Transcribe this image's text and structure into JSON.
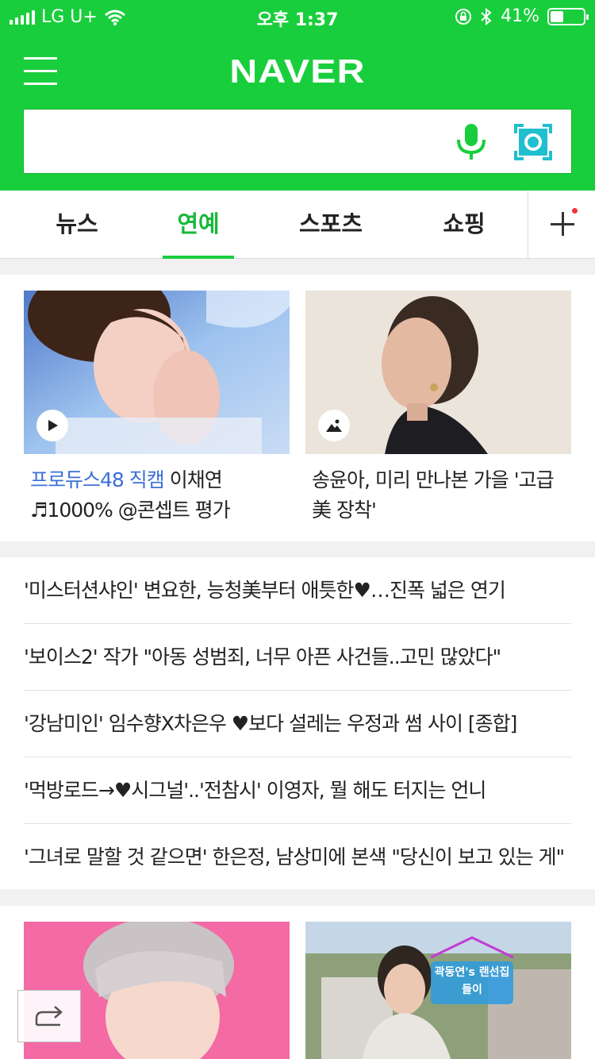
{
  "status": {
    "carrier": "LG U+",
    "time": "오후 1:37",
    "battery_text": "41%",
    "battery_level": 0.41
  },
  "header": {
    "logo": "NAVER",
    "search_value": ""
  },
  "tabs": [
    {
      "label": "뉴스",
      "active": false
    },
    {
      "label": "연예",
      "active": true
    },
    {
      "label": "스포츠",
      "active": false
    },
    {
      "label": "쇼핑",
      "active": false
    }
  ],
  "cards": [
    {
      "tag": "프로듀스48 직캠",
      "title": " 이채연 ♬1000% @콘셉트 평가",
      "media": "play-icon"
    },
    {
      "title": "송윤아, 미리 만나본 가을 '고급美 장착'",
      "media": "photo-icon"
    }
  ],
  "news": [
    "'미스터션샤인' 변요한, 능청美부터 애틋한♥…진폭 넓은 연기",
    "'보이스2' 작가 \"아동 성범죄, 너무 아픈 사건들..고민 많았다\"",
    "'강남미인' 임수향X차은우 ♥보다 설레는 우정과 썸 사이 [종합]",
    "'먹방로드→♥시그널'..'전참시' 이영자, 뭘 해도 터지는 언니",
    "'그녀로 말할 것 같으면' 한은정, 남상미에 본색 \"당신이 보고 있는 게\""
  ],
  "lower_cards": [
    {
      "overlay": ""
    },
    {
      "overlay": "곽동연's 랜선집들이"
    }
  ],
  "colors": {
    "brand": "#19ce3c",
    "highlight": "#3c70d6",
    "notify_dot": "#f2343a"
  }
}
